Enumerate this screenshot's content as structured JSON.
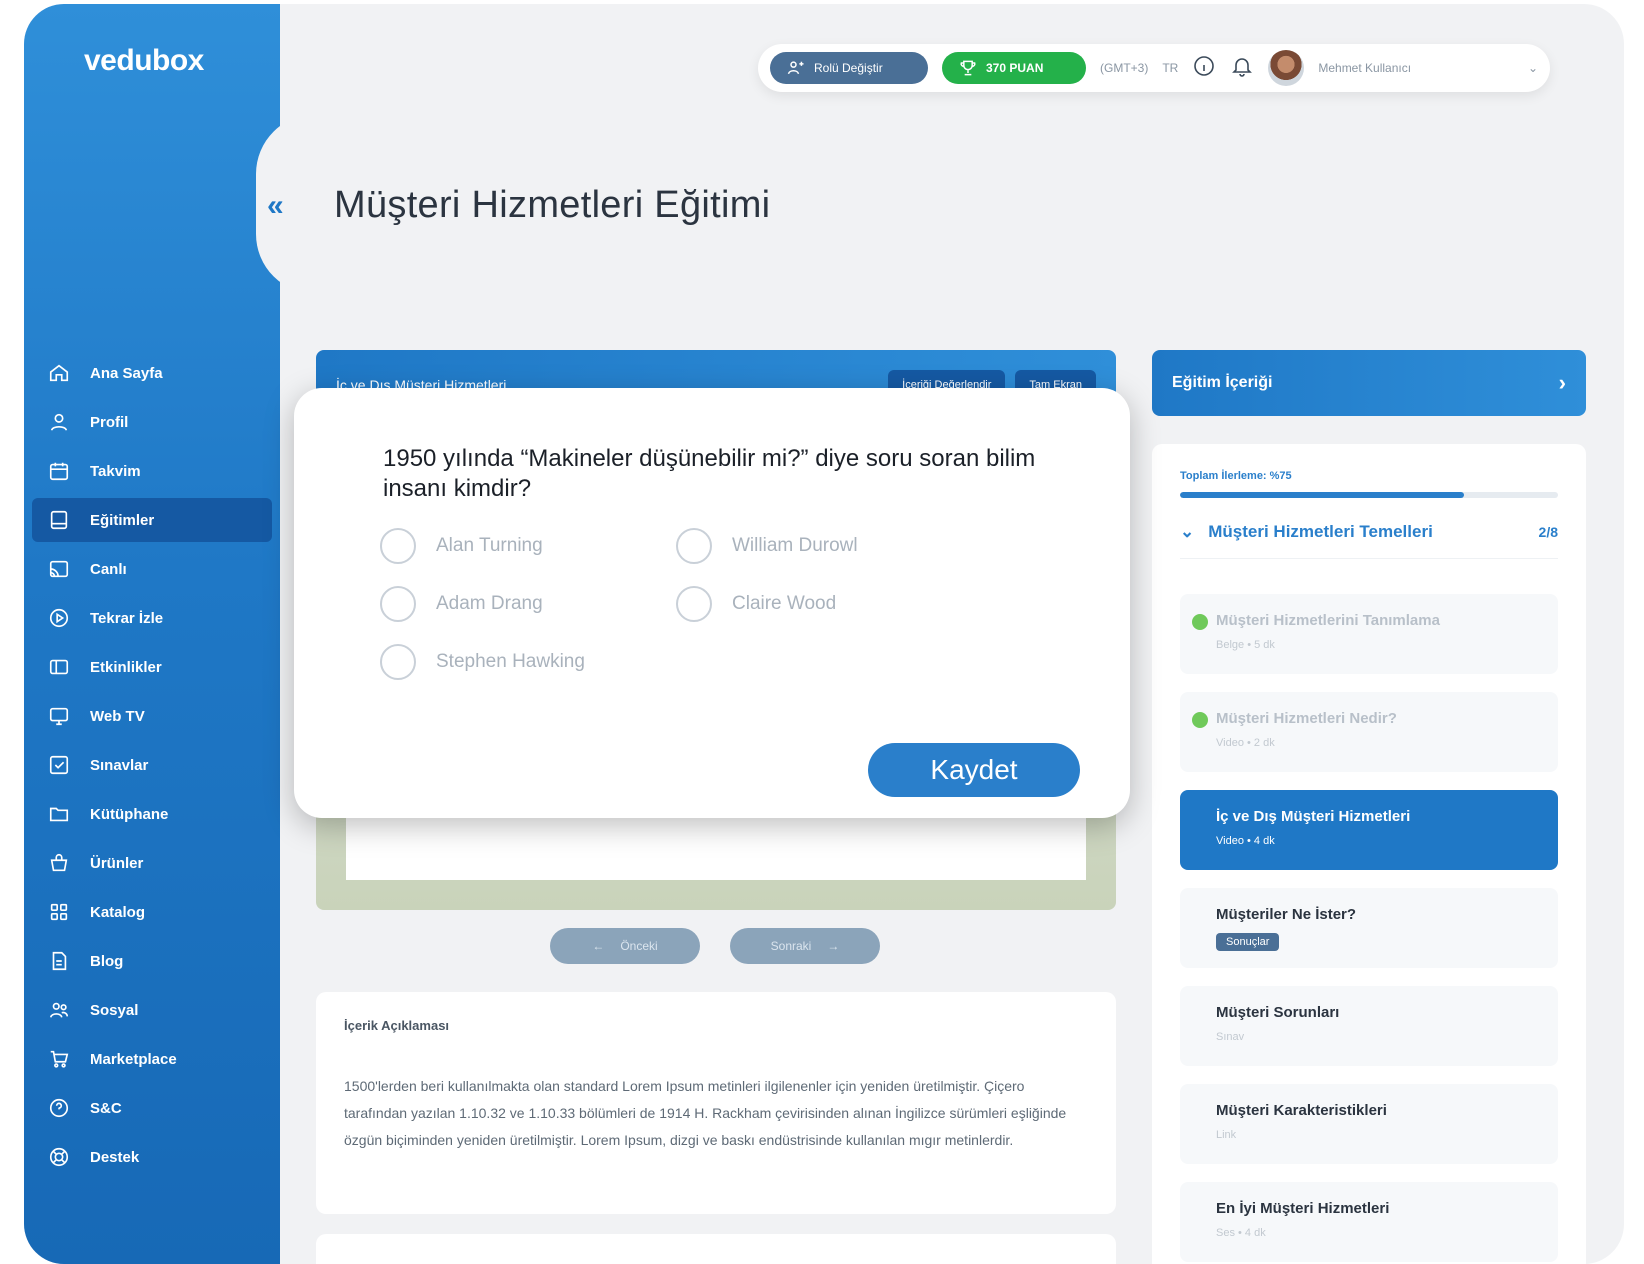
{
  "brand": {
    "logo": "vedubox"
  },
  "topbar": {
    "role_label": "Rolü Değiştir",
    "points_label": "370 PUAN",
    "timezone": "(GMT+3)",
    "language": "TR",
    "user_name": "Mehmet Kullanıcı"
  },
  "sidebar": {
    "items": [
      {
        "label": "Ana Sayfa",
        "icon": "home-icon"
      },
      {
        "label": "Profil",
        "icon": "user-icon"
      },
      {
        "label": "Takvim",
        "icon": "calendar-icon"
      },
      {
        "label": "Eğitimler",
        "icon": "book-icon",
        "active": true
      },
      {
        "label": "Canlı",
        "icon": "cast-icon"
      },
      {
        "label": "Tekrar İzle",
        "icon": "replay-icon"
      },
      {
        "label": "Etkinlikler",
        "icon": "ticket-icon"
      },
      {
        "label": "Web TV",
        "icon": "tv-icon"
      },
      {
        "label": "Sınavlar",
        "icon": "exam-icon"
      },
      {
        "label": "Kütüphane",
        "icon": "folder-icon"
      },
      {
        "label": "Ürünler",
        "icon": "basket-icon"
      },
      {
        "label": "Katalog",
        "icon": "grid-icon"
      },
      {
        "label": "Blog",
        "icon": "document-icon"
      },
      {
        "label": "Sosyal",
        "icon": "users-icon"
      },
      {
        "label": "Marketplace",
        "icon": "cart-icon"
      },
      {
        "label": "S&C",
        "icon": "help-icon"
      },
      {
        "label": "Destek",
        "icon": "support-icon"
      }
    ]
  },
  "page": {
    "title": "Müşteri Hizmetleri Eğitimi"
  },
  "video": {
    "title": "İç ve Dış Müşteri Hizmetleri",
    "rate_label": "İçeriği Değerlendir",
    "fullscreen_label": "Tam Ekran",
    "prev_label": "Önceki",
    "next_label": "Sonraki"
  },
  "quiz": {
    "question": "1950 yılında “Makineler düşünebilir mi?” diye soru soran bilim insanı kimdir?",
    "options": [
      "Alan Turning",
      "William Durowl",
      "Adam Drang",
      "Claire Wood",
      "Stephen Hawking"
    ],
    "save_label": "Kaydet"
  },
  "description": {
    "title": "İçerik Açıklaması",
    "text": "1500'lerden beri kullanılmakta olan standard Lorem Ipsum metinleri ilgilenenler için yeniden üretilmiştir. Çiçero tarafından yazılan 1.10.32 ve 1.10.33 bölümleri de 1914 H. Rackham çevirisinden alınan İngilizce sürümleri eşliğinde özgün biçiminden yeniden üretilmiştir. Lorem Ipsum, dizgi ve baskı endüstrisinde kullanılan mıgır metinlerdir."
  },
  "content_panel": {
    "header": "Eğitim İçeriği",
    "progress_label": "Toplam İlerleme: %75",
    "progress": 0.75,
    "module_title": "Müşteri Hizmetleri Temelleri",
    "module_count": "2/8",
    "lessons": [
      {
        "title": "Müşteri Hizmetlerini Tanımlama",
        "meta": "Belge • 5 dk",
        "done": true
      },
      {
        "title": "Müşteri Hizmetleri Nedir?",
        "meta": "Video • 2 dk",
        "done": true
      },
      {
        "title": "İç ve Dış Müşteri Hizmetleri",
        "meta": "Video • 4 dk",
        "active": true
      },
      {
        "title": "Müşteriler Ne İster?",
        "badge": "Sonuçlar"
      },
      {
        "title": "Müşteri Sorunları",
        "meta": "Sınav"
      },
      {
        "title": "Müşteri Karakteristikleri",
        "meta": "Link"
      },
      {
        "title": "En İyi Müşteri Hizmetleri",
        "meta": "Ses • 4 dk"
      }
    ]
  },
  "colors": {
    "primary": "#1f78c6",
    "success": "#24b14a",
    "sidebar_active": "#1559a3"
  }
}
